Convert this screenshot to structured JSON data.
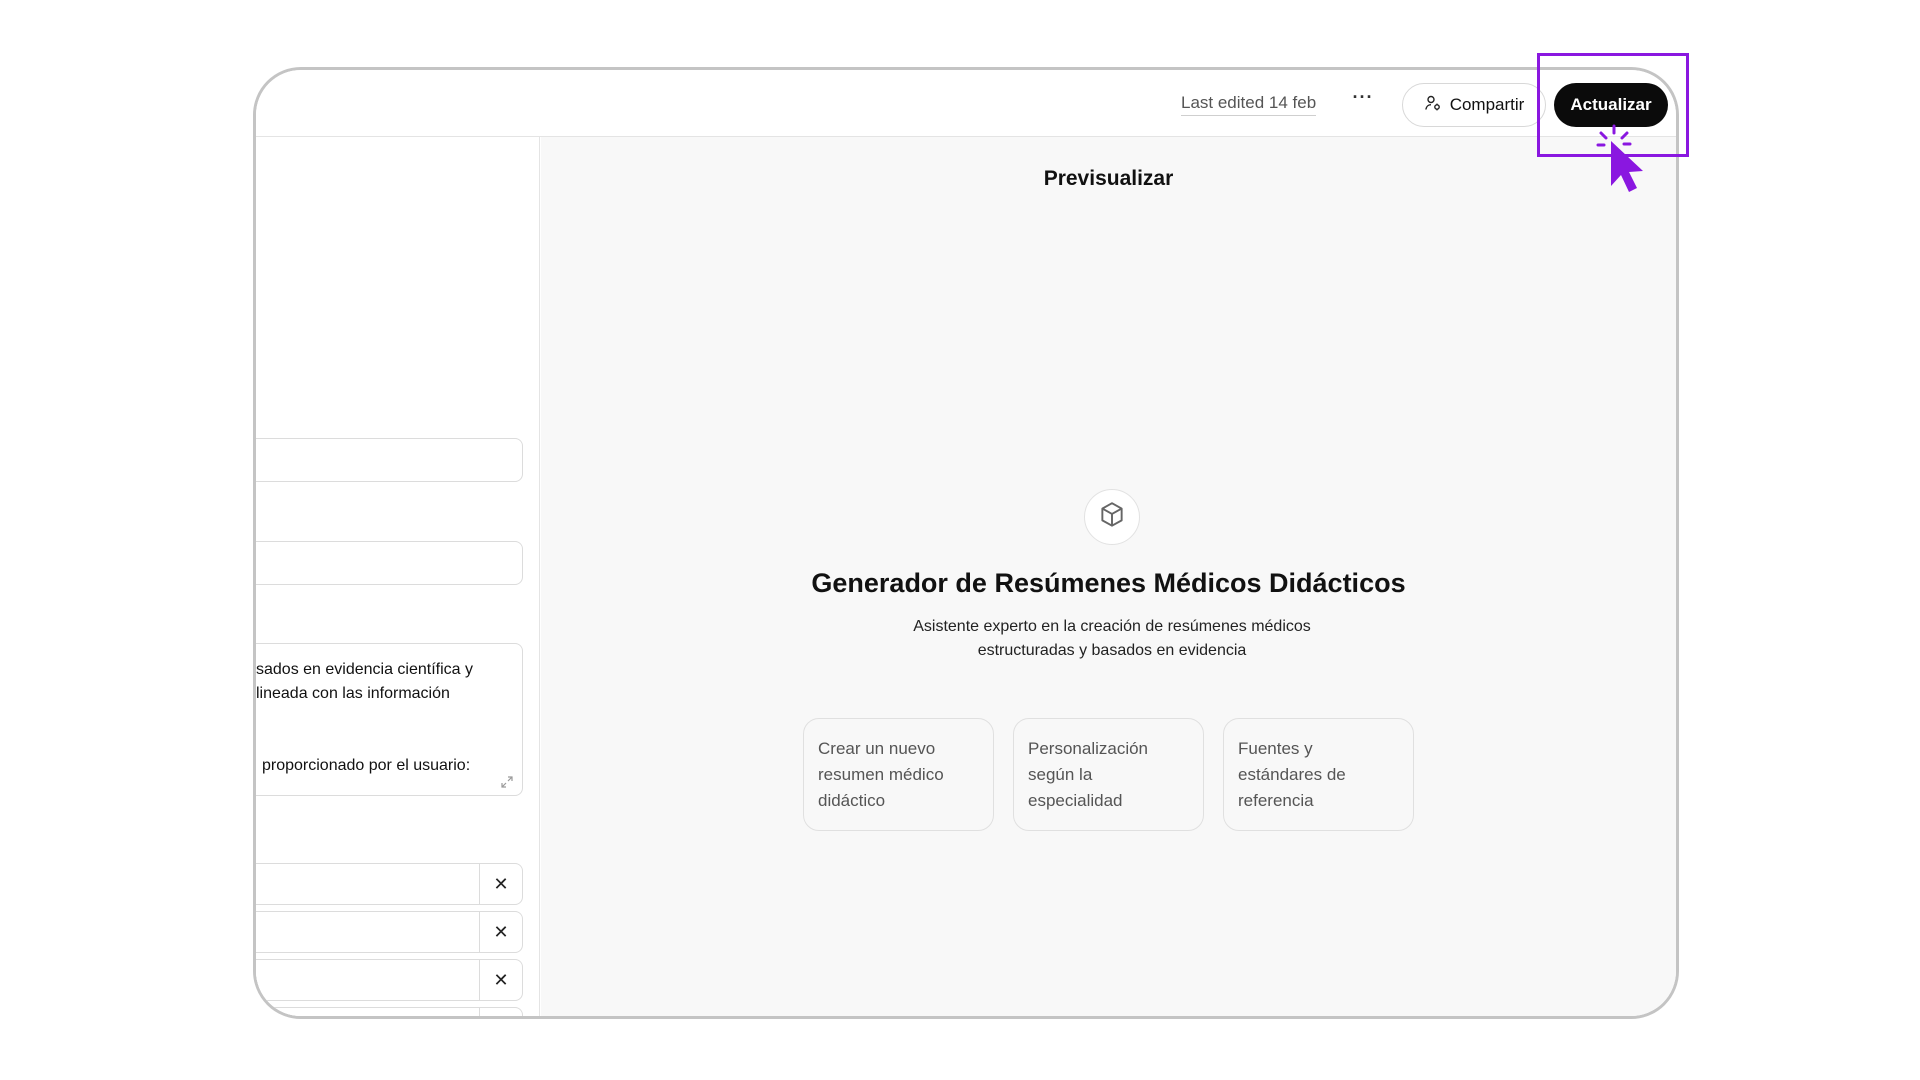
{
  "header": {
    "last_edited": "Last edited 14 feb",
    "more_label": "···",
    "share_label": "Compartir",
    "update_label": "Actualizar"
  },
  "left_panel": {
    "textarea_lines": [
      "sados en evidencia científica y",
      "lineada con las información",
      "proporcionado por el usuario:"
    ],
    "remove_label": "✕"
  },
  "preview": {
    "title": "Previsualizar",
    "agent_name": "Generador de Resúmenes Médicos Didácticos",
    "agent_description": "Asistente experto en la creación de resúmenes médicos estructuradas y basados en evidencia",
    "suggestions": [
      "Crear un nuevo resumen médico didáctico",
      "Personalización según la especialidad",
      "Fuentes y estándares de referencia"
    ]
  },
  "icons": {
    "share": "user-share-icon",
    "cube": "cube-icon",
    "resize": "resize-icon",
    "cursor": "click-cursor-icon"
  },
  "colors": {
    "highlight": "#8a17e0",
    "primary_button": "#0b0b0b"
  }
}
